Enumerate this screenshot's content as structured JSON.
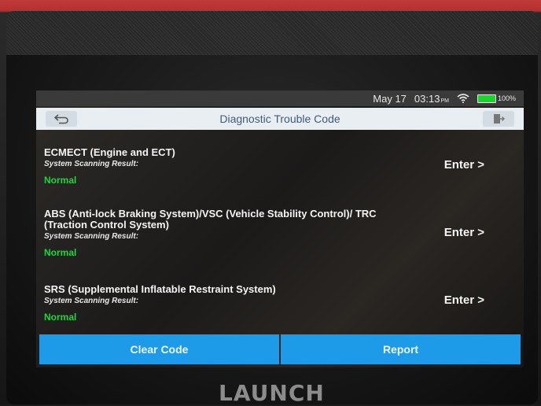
{
  "status": {
    "date": "May 17",
    "time": "03:13",
    "ampm": "PM",
    "battery": "100%",
    "wifi_icon": "wifi-icon"
  },
  "header": {
    "title": "Diagnostic Trouble Code",
    "back_icon": "back-arrow-icon",
    "exit_icon": "exit-door-icon"
  },
  "systems": [
    {
      "name": "ECMECT (Engine and ECT)",
      "scan_label": "System Scanning Result:",
      "result": "Normal",
      "enter": "Enter >"
    },
    {
      "name": "ABS (Anti-lock Braking System)/VSC (Vehicle Stability Control)/ TRC (Traction Control System)",
      "scan_label": "System Scanning Result:",
      "result": "Normal",
      "enter": "Enter >"
    },
    {
      "name": "SRS (Supplemental Inflatable Restraint System)",
      "scan_label": "System Scanning Result:",
      "result": "Normal",
      "enter": "Enter >"
    }
  ],
  "actions": {
    "clear_code": "Clear Code",
    "report": "Report"
  },
  "device": {
    "brand": "LAUNCH"
  },
  "colors": {
    "accent_blue": "#1e9be8",
    "normal_green": "#18d93a",
    "title_text": "#3f5b7a"
  }
}
